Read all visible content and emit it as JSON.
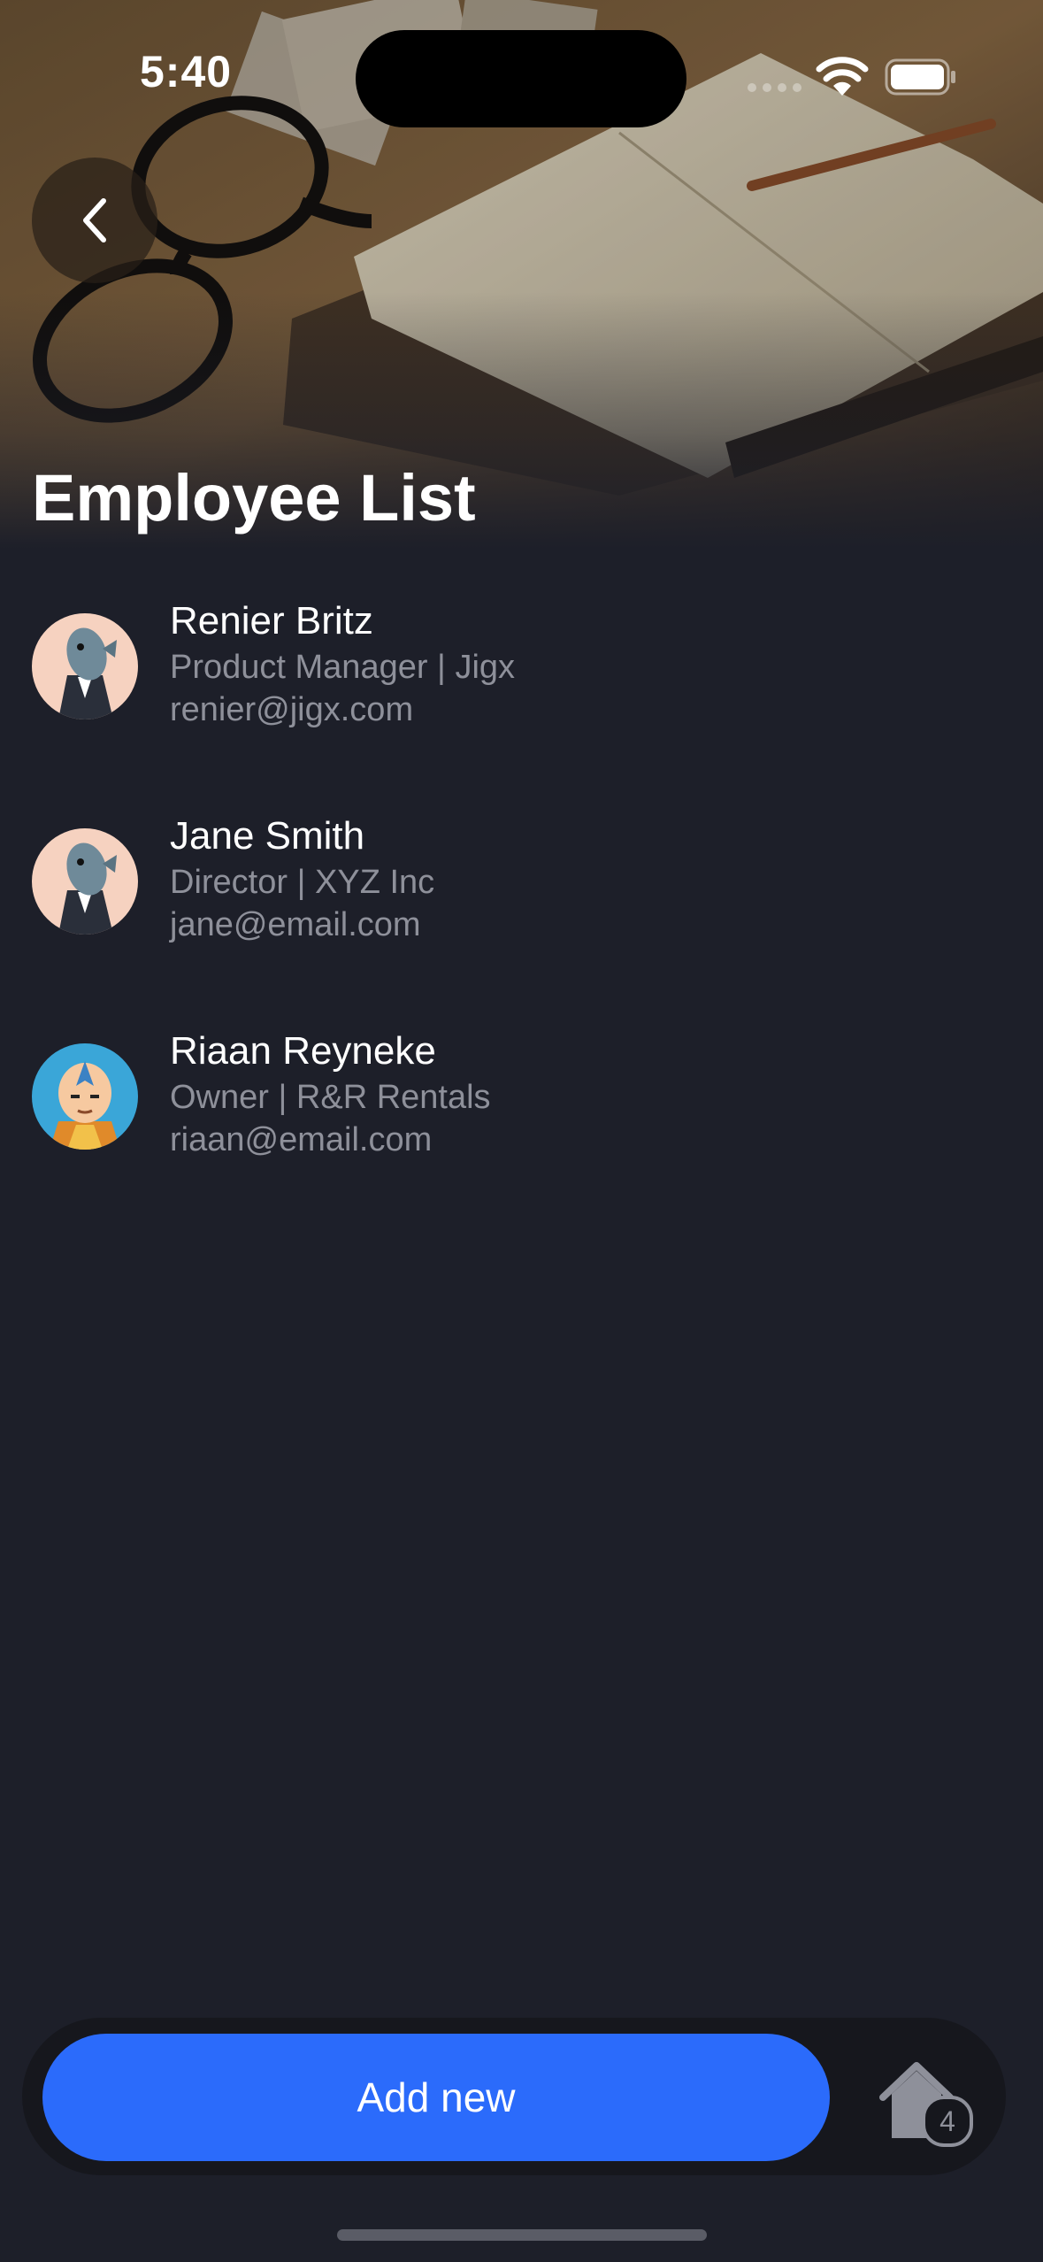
{
  "status_bar": {
    "time": "5:40"
  },
  "header": {
    "title": "Employee List",
    "back_icon": "chevron-left-icon"
  },
  "employees": [
    {
      "name": "Renier Britz",
      "subtitle": "Product Manager | Jigx",
      "email": "renier@jigx.com",
      "avatar": "fish-in-suit-avatar"
    },
    {
      "name": "Jane Smith",
      "subtitle": "Director | XYZ Inc",
      "email": "jane@email.com",
      "avatar": "fish-in-suit-avatar"
    },
    {
      "name": "Riaan Reyneke",
      "subtitle": "Owner | R&R Rentals",
      "email": "riaan@email.com",
      "avatar": "cartoon-monk-avatar"
    }
  ],
  "bottom_bar": {
    "add_label": "Add new",
    "home_icon": "home-icon",
    "home_badge": "4"
  },
  "colors": {
    "background": "#1d1f29",
    "accent": "#2b6bfb",
    "secondary_text": "#8e909a"
  }
}
